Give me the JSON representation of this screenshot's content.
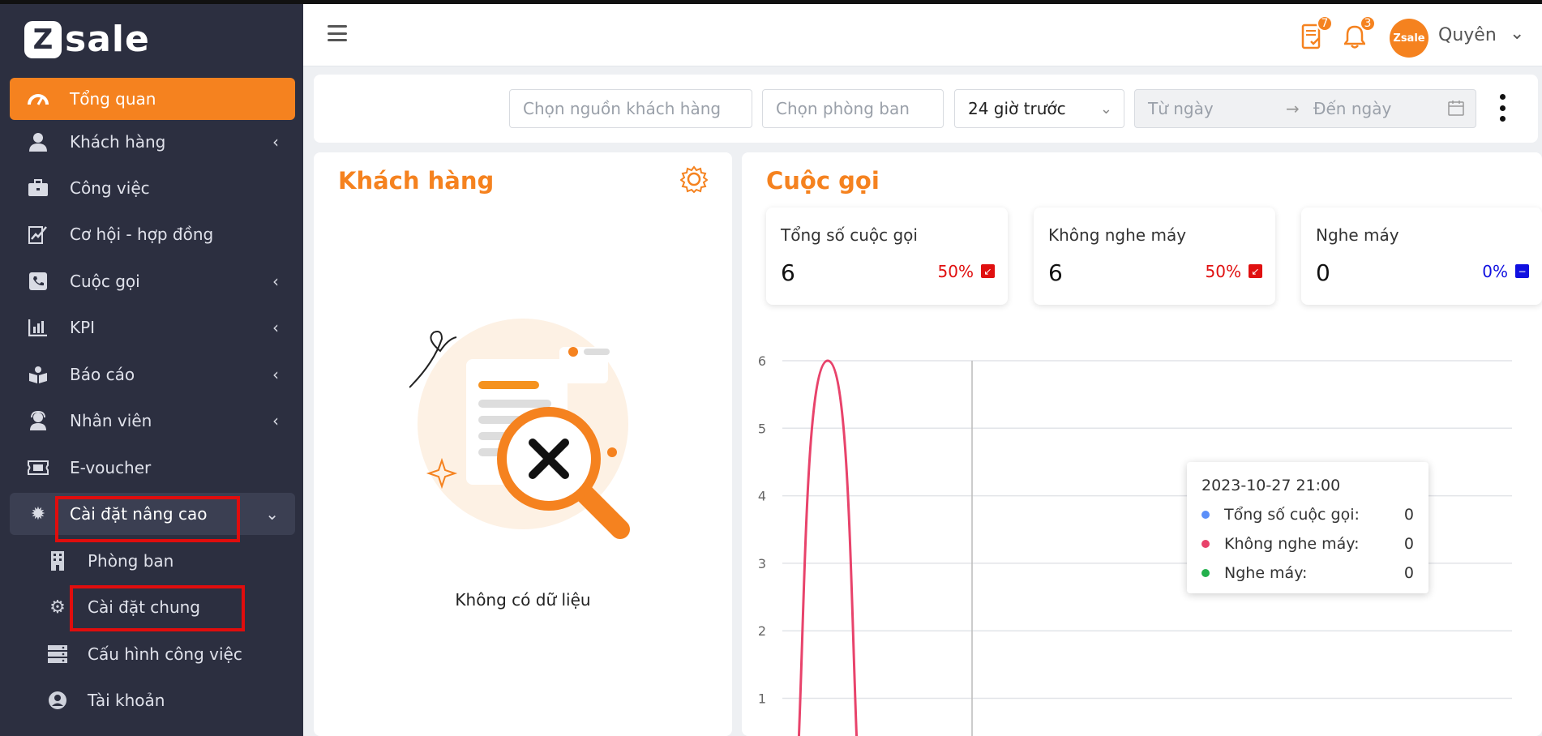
{
  "brand": {
    "logo_letter": "Z",
    "logo_text": "sale"
  },
  "sidebar": {
    "items": [
      {
        "label": "Tổng quan",
        "icon": "dashboard-icon"
      },
      {
        "label": "Khách hàng",
        "icon": "user-icon"
      },
      {
        "label": "Công việc",
        "icon": "briefcase-icon"
      },
      {
        "label": "Cơ hội - hợp đồng",
        "icon": "contract-icon"
      },
      {
        "label": "Cuộc gọi",
        "icon": "phone-icon"
      },
      {
        "label": "KPI",
        "icon": "bar-chart-icon"
      },
      {
        "label": "Báo cáo",
        "icon": "report-icon"
      },
      {
        "label": "Nhân viên",
        "icon": "staff-icon"
      },
      {
        "label": "E-voucher",
        "icon": "ticket-icon"
      },
      {
        "label": "Cài đặt nâng cao",
        "icon": "gear-icon"
      }
    ],
    "subitems": [
      {
        "label": "Phòng ban",
        "icon": "building-icon"
      },
      {
        "label": "Cài đặt chung",
        "icon": "gear-icon"
      },
      {
        "label": "Cấu hình công việc",
        "icon": "server-icon"
      },
      {
        "label": "Tài khoản",
        "icon": "account-icon"
      }
    ]
  },
  "topbar": {
    "task_badge": "7",
    "notification_badge": "3",
    "avatar_text": "Zsale",
    "username": "Quyên"
  },
  "filters": {
    "customer_source_placeholder": "Chọn nguồn khách hàng",
    "department_placeholder": "Chọn phòng ban",
    "time_range_value": "24 giờ trước",
    "from_date_placeholder": "Từ ngày",
    "to_date_placeholder": "Đến ngày"
  },
  "customers_card": {
    "title": "Khách hàng",
    "empty_text": "Không có dữ liệu"
  },
  "calls_card": {
    "title": "Cuộc gọi",
    "stats": [
      {
        "label": "Tổng số cuộc gọi",
        "value": "6",
        "percent": "50%",
        "trend": "down",
        "color": "#e01010"
      },
      {
        "label": "Không nghe máy",
        "value": "6",
        "percent": "50%",
        "trend": "down",
        "color": "#e01010"
      },
      {
        "label": "Nghe máy",
        "value": "0",
        "percent": "0%",
        "trend": "flat",
        "color": "#1010e0"
      }
    ]
  },
  "chart_data": {
    "type": "line",
    "ylim": [
      0,
      6
    ],
    "y_ticks": [
      "1",
      "2",
      "3",
      "4",
      "5",
      "6"
    ],
    "series": [
      {
        "name": "Tổng số cuộc gọi",
        "color": "#5b8ff9",
        "peak": 6
      },
      {
        "name": "Không nghe máy",
        "color": "#e8436b",
        "peak": 6
      },
      {
        "name": "Nghe máy",
        "color": "#23b04c",
        "peak": 0
      }
    ],
    "tooltip": {
      "title": "2023-10-27 21:00",
      "rows": [
        {
          "name": "Tổng số cuộc gọi:",
          "value": "0",
          "color": "#5b8ff9"
        },
        {
          "name": "Không nghe máy:",
          "value": "0",
          "color": "#e8436b"
        },
        {
          "name": "Nghe máy:",
          "value": "0",
          "color": "#23b04c"
        }
      ]
    }
  }
}
